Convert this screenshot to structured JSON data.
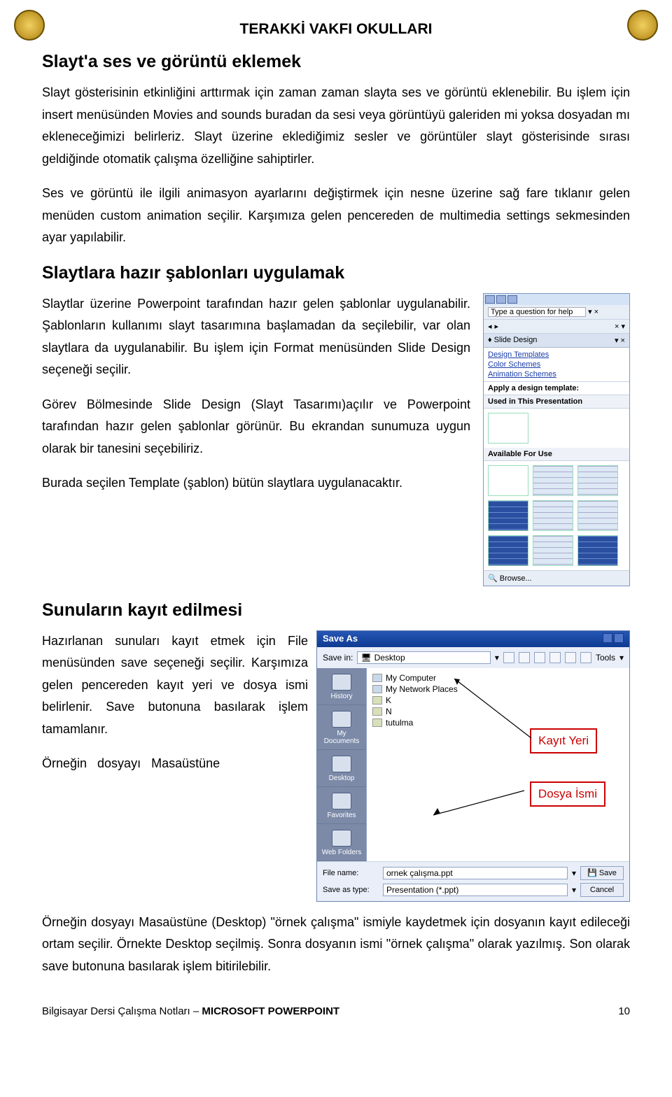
{
  "header": {
    "org": "TERAKKİ VAKFI OKULLARI"
  },
  "sections": {
    "s1_title": "Slayt'a ses ve görüntü eklemek",
    "s1_p1": "Slayt gösterisinin etkinliğini arttırmak için zaman zaman slayta ses ve görüntü eklenebilir. Bu işlem için insert menüsünden Movies and sounds buradan da sesi veya görüntüyü galeriden mi yoksa dosyadan mı ekleneceğimizi belirleriz. Slayt üzerine eklediğimiz sesler ve görüntüler slayt gösterisinde sırası geldiğinde otomatik çalışma özelliğine sahiptirler.",
    "s1_p2": "Ses ve görüntü ile ilgili animasyon ayarlarını değiştirmek için nesne üzerine sağ fare tıklanır gelen menüden custom animation seçilir. Karşımıza gelen pencereden de multimedia settings sekmesinden ayar yapılabilir.",
    "s2_title": "Slaytlara hazır şablonları uygulamak",
    "s2_p1": "Slaytlar üzerine Powerpoint tarafından hazır gelen şablonlar uygulanabilir. Şablonların kullanımı slayt tasarımına başlamadan da seçilebilir, var olan slaytlara da uygulanabilir. Bu işlem için Format menüsünden Slide Design seçeneği seçilir.",
    "s2_p2": "Görev Bölmesinde Slide Design (Slayt Tasarımı)açılır ve Powerpoint tarafından hazır gelen şablonlar görünür. Bu ekrandan sunumuza uygun olarak bir tanesini seçebiliriz.",
    "s2_p3": "Burada seçilen Template (şablon) bütün slaytlara uygulanacaktır.",
    "s3_title": "Sunuların kayıt edilmesi",
    "s3_p1": "Hazırlanan sunuları kayıt etmek için File menüsünden save seçeneği seçilir. Karşımıza gelen pencereden kayıt yeri ve dosya ismi belirlenir. Save butonuna basılarak işlem tamamlanır.",
    "s3_p2": "Örneğin dosyayı Masaüstüne (Desktop) \"örnek çalışma\" ismiyle kaydetmek için dosyanın kayıt edileceği ortam seçilir. Örnekte Desktop seçilmiş. Sonra dosyanın ismi \"örnek çalışma\" olarak yazılmış. Son olarak save butonuna basılarak işlem bitirilebilir."
  },
  "slide_design_panel": {
    "help_placeholder": "Type a question for help",
    "title": "Slide Design",
    "links": {
      "templates": "Design Templates",
      "colors": "Color Schemes",
      "anim": "Animation Schemes"
    },
    "apply_label": "Apply a design template:",
    "used_label": "Used in This Presentation",
    "avail_label": "Available For Use",
    "browse": "Browse..."
  },
  "saveas": {
    "title": "Save As",
    "savein_label": "Save in:",
    "savein_value": "Desktop",
    "tools": "Tools",
    "places": {
      "history": "History",
      "mydocs": "My Documents",
      "desktop": "Desktop",
      "favorites": "Favorites",
      "web": "Web Folders"
    },
    "list": {
      "i1": "My Computer",
      "i2": "My Network Places",
      "i3": "K",
      "i4": "N",
      "i5": "tutulma"
    },
    "filename_label": "File name:",
    "filename_value": "ornek çalışma.ppt",
    "savetype_label": "Save as type:",
    "savetype_value": "Presentation (*.ppt)",
    "save_btn": "Save",
    "cancel_btn": "Cancel"
  },
  "callouts": {
    "a": "Kayıt Yeri",
    "b": "Dosya İsmi"
  },
  "footer": {
    "left": "Bilgisayar Dersi Çalışma Notları – MICROSOFT POWERPOINT",
    "right": "10"
  }
}
